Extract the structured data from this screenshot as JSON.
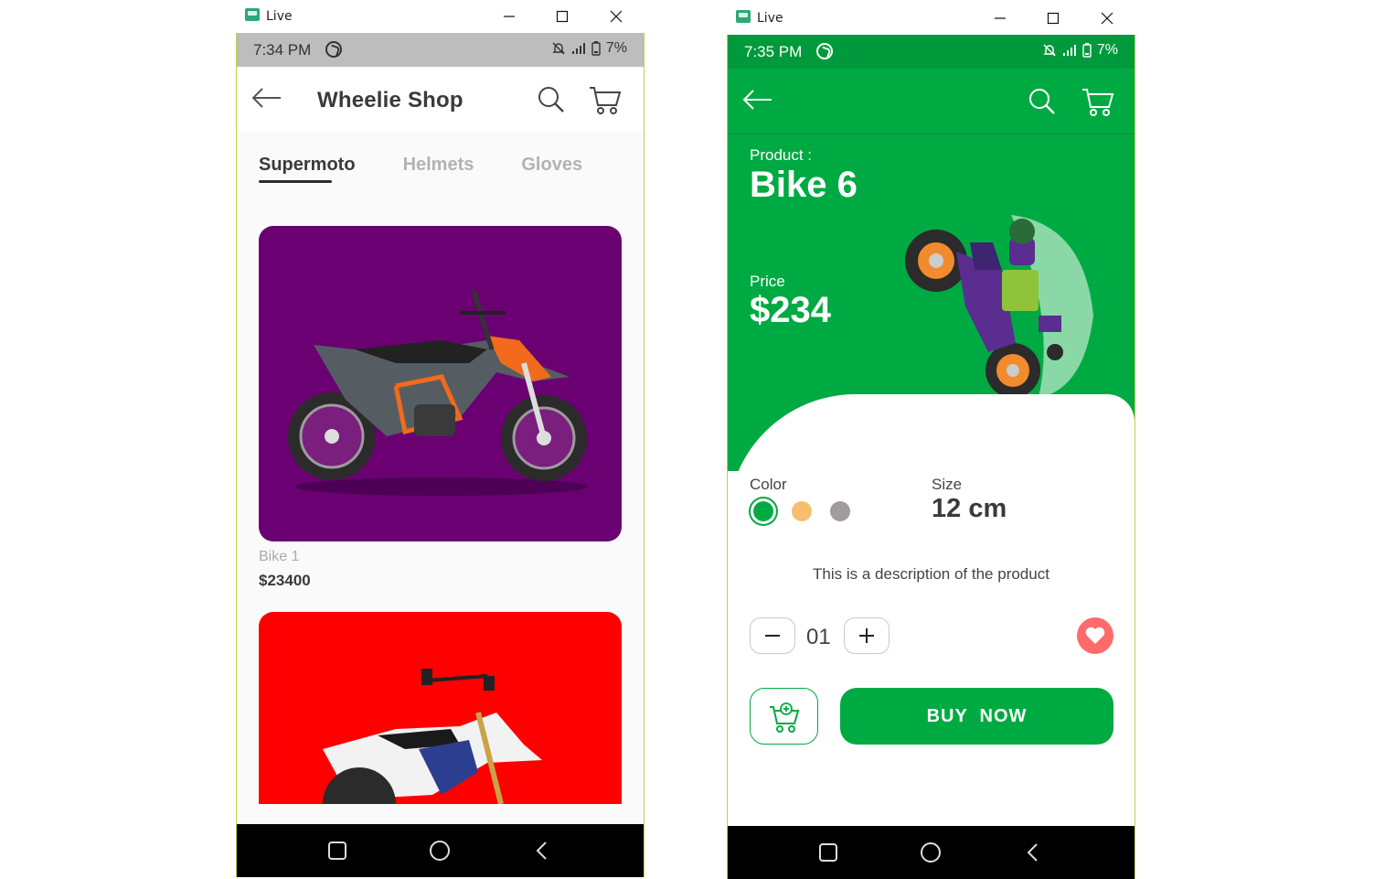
{
  "colors": {
    "left_status": "#bdbdbd",
    "green": "#00aa43",
    "purple_card": "#6a0072",
    "red_card": "#fe0000",
    "heart": "#ff6b6b"
  },
  "windows": [
    {
      "title": "Live",
      "status": {
        "time": "7:34 PM",
        "battery": "7%"
      },
      "header": {
        "title": "Wheelie Shop",
        "back_icon": "arrow-left-icon",
        "search_icon": "search-icon",
        "cart_icon": "cart-icon"
      },
      "tabs": [
        {
          "label": "Supermoto",
          "active": true
        },
        {
          "label": "Helmets"
        },
        {
          "label": "Gloves"
        }
      ],
      "products": [
        {
          "name": "Bike 1",
          "price": "$23400"
        }
      ]
    },
    {
      "title": "Live",
      "status": {
        "time": "7:35 PM",
        "battery": "7%"
      },
      "detail": {
        "product_label": "Product :",
        "product_name": "Bike 6",
        "price_label": "Price",
        "price": "$234",
        "color_label": "Color",
        "size_label": "Size",
        "size": "12 cm",
        "description": "This is a description of the product",
        "quantity": "01",
        "buy_label": "BUY  NOW",
        "swatches": [
          "#00aa43",
          "#f7be6e",
          "#a09c9c"
        ]
      }
    }
  ]
}
